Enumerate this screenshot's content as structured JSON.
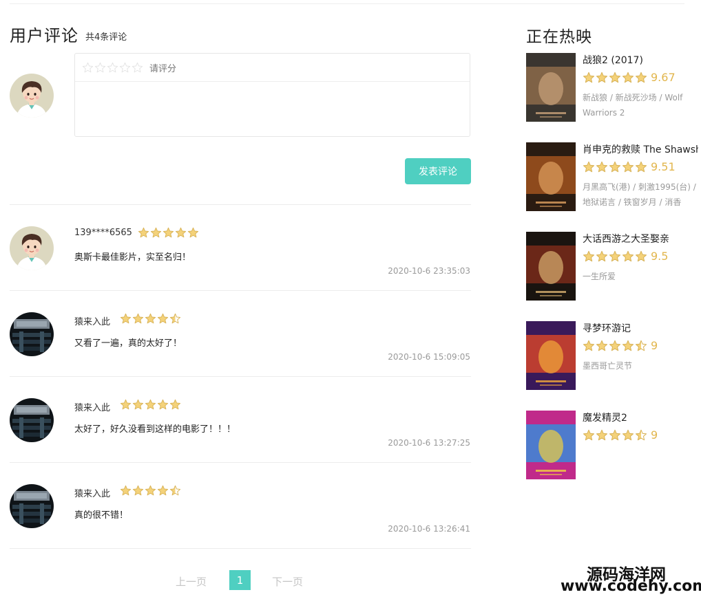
{
  "comments_section": {
    "title": "用户评论",
    "count_text": "共4条评论",
    "editor": {
      "rating_hint": "请评分",
      "rating_value": 0,
      "text_value": ""
    },
    "submit_label": "发表评论",
    "comments": [
      {
        "user": "139****6565",
        "rating": 5,
        "text": "奥斯卡最佳影片，实至名归！",
        "time": "2020-10-6 23:35:03",
        "avatar": "cartoon-avatar"
      },
      {
        "user": "猿来入此",
        "rating": 4.5,
        "text": "又看了一遍，真的太好了！",
        "time": "2020-10-6 15:09:05",
        "avatar": "theater-avatar"
      },
      {
        "user": "猿来入此",
        "rating": 5,
        "text": "太好了，好久没看到这样的电影了！！！",
        "time": "2020-10-6 13:27:25",
        "avatar": "theater-avatar"
      },
      {
        "user": "猿来入此",
        "rating": 4.5,
        "text": "真的很不错！",
        "time": "2020-10-6 13:26:41",
        "avatar": "theater-avatar"
      }
    ],
    "pagination": {
      "prev_label": "上一页",
      "current_page": "1",
      "next_label": "下一页"
    }
  },
  "now_showing": {
    "title": "正在热映",
    "movies": [
      {
        "title": "战狼2 (2017)",
        "rating": 5,
        "score": "9.67",
        "alias": "新战狼 / 新战死沙场 / Wolf Warriors 2",
        "poster_colors": [
          "#3a3530",
          "#8c6a4a",
          "#c9a27a"
        ]
      },
      {
        "title": "肖申克的救赎 The Shawshank Redemption",
        "rating": 5,
        "score": "9.51",
        "alias": "月黑高飞(港) / 刺激1995(台) / 地狱诺言 / 铁窗岁月 / 消香",
        "poster_colors": [
          "#2a1c12",
          "#a0521e",
          "#e0a060"
        ]
      },
      {
        "title": "大话西游之大圣娶亲",
        "rating": 5,
        "score": "9.5",
        "alias": "一生所爱",
        "poster_colors": [
          "#1a1410",
          "#7a2a1a",
          "#d8b070"
        ]
      },
      {
        "title": "寻梦环游记",
        "rating": 4.5,
        "score": "9",
        "alias": "墨西哥亡灵节",
        "poster_colors": [
          "#3a1a5a",
          "#d2442a",
          "#f2a93a"
        ]
      },
      {
        "title": "魔发精灵2",
        "rating": 4.5,
        "score": "9",
        "alias": "",
        "poster_colors": [
          "#c02a8a",
          "#3a8ad8",
          "#f0d040"
        ]
      }
    ]
  },
  "watermark": {
    "cn": "源码海洋网",
    "url": "www.codehy.com"
  },
  "colors": {
    "accent": "#4fcfc1",
    "star_fill": "#f4d27a",
    "star_stroke": "#d9b45a",
    "star_empty": "#e4e4e4"
  }
}
